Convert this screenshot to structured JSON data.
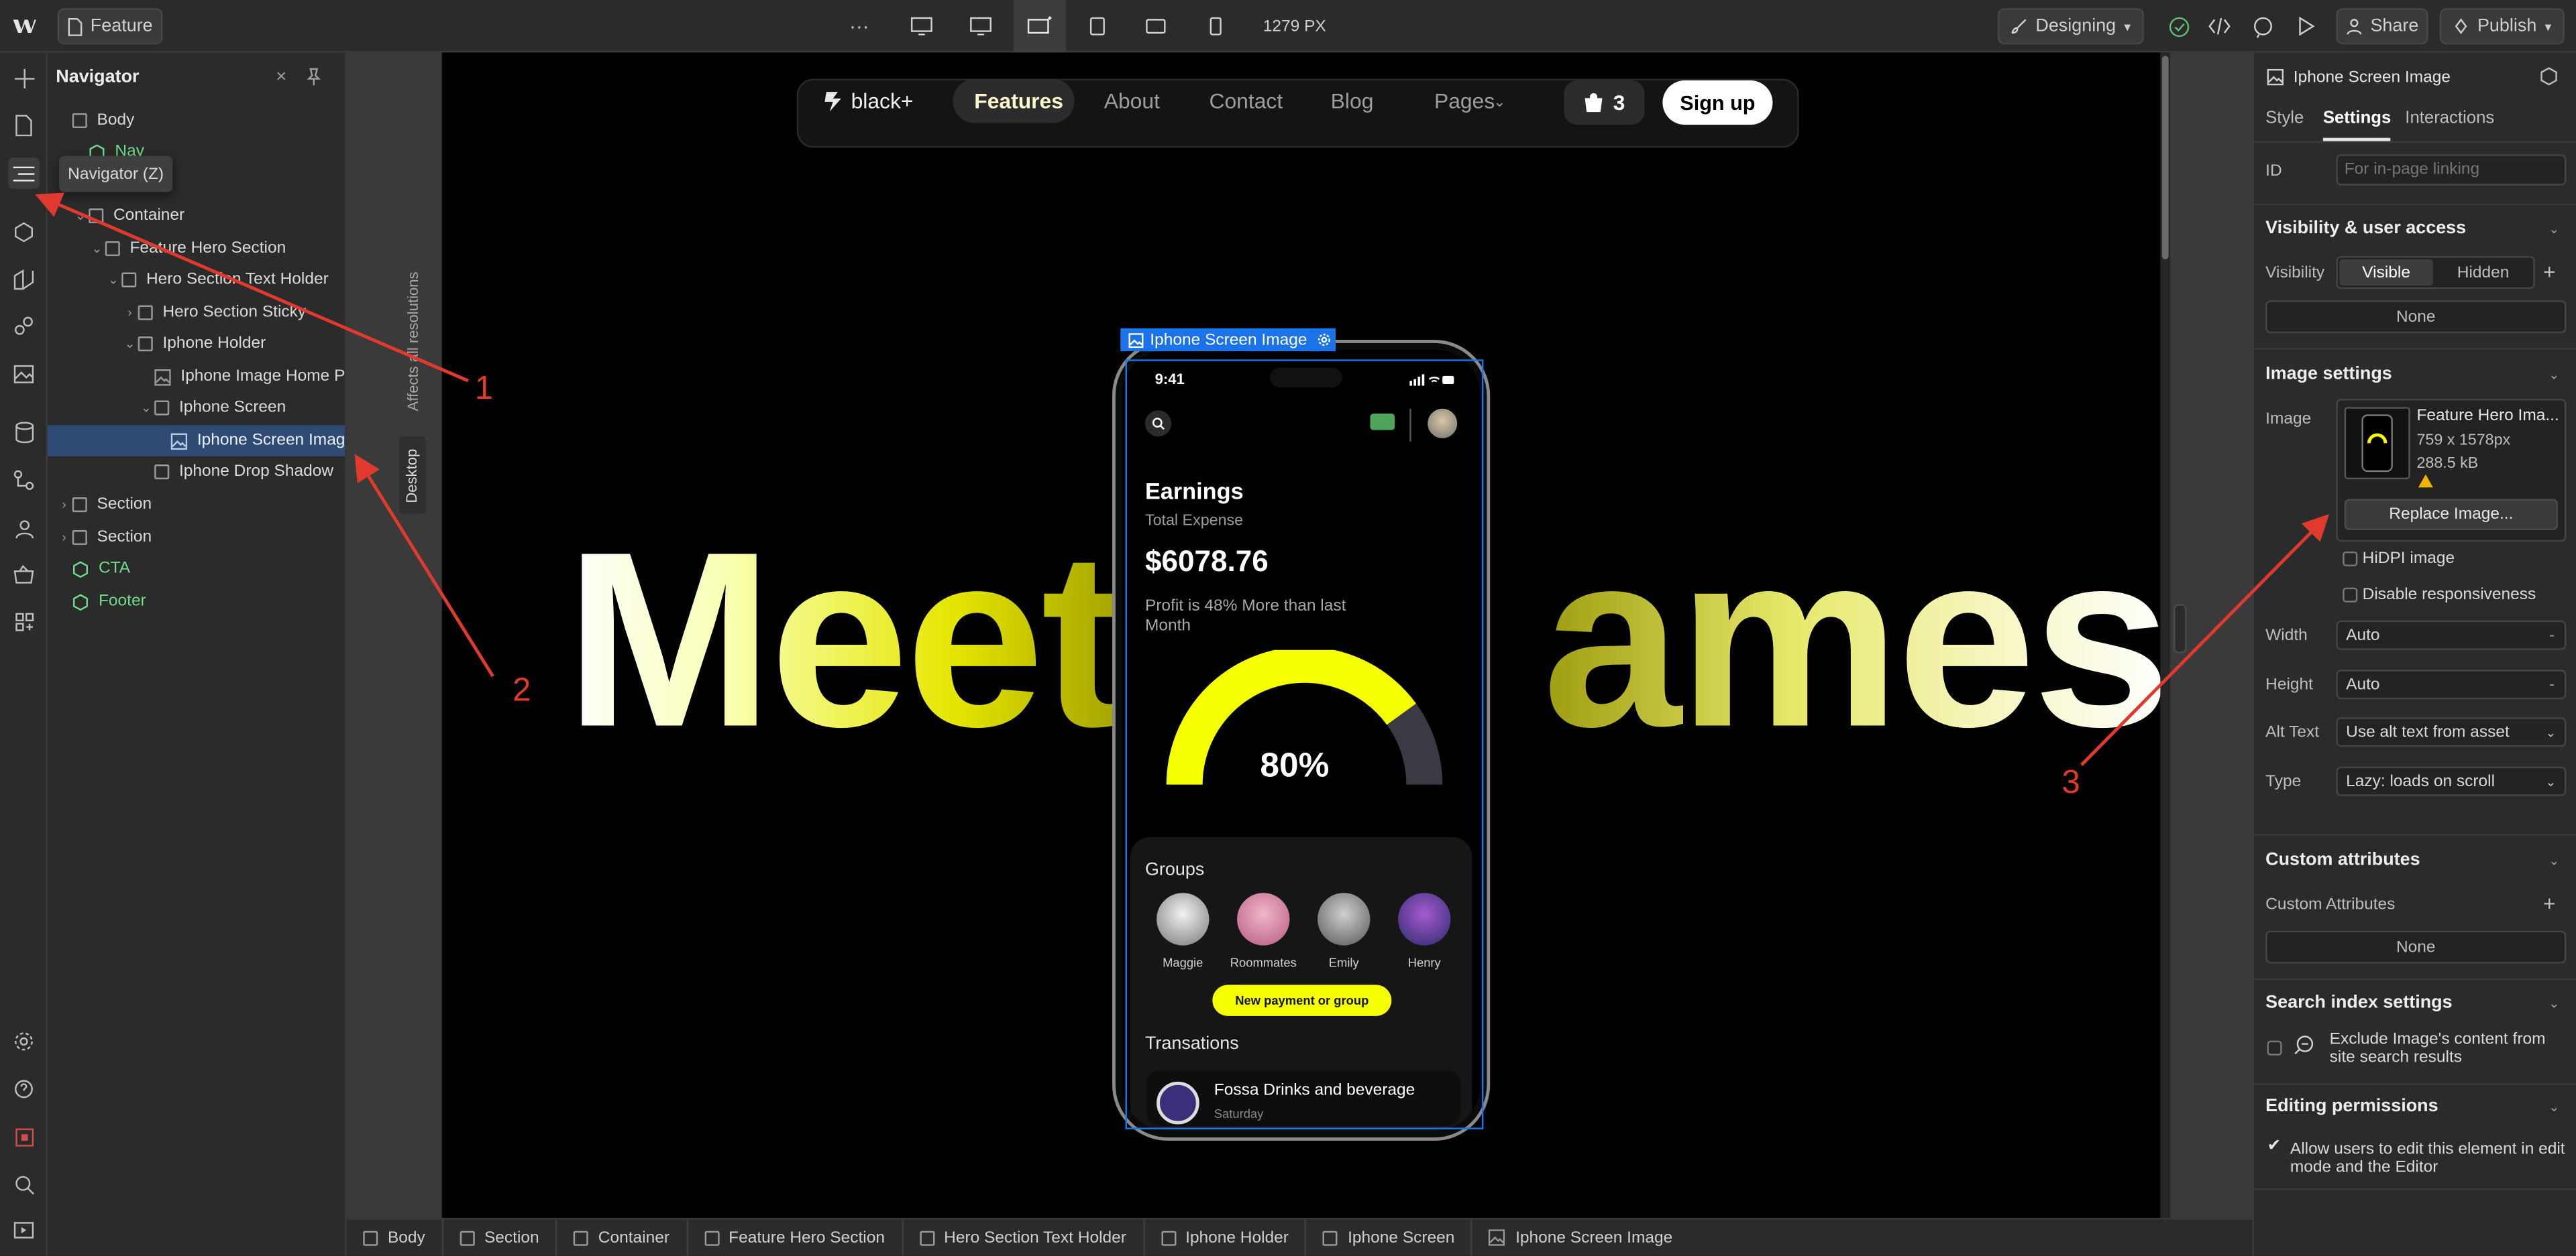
{
  "topbar": {
    "page_name": "Feature",
    "more": "···",
    "width_readout": "1279 PX",
    "mode": "Designing",
    "share": "Share",
    "publish": "Publish"
  },
  "tooltip": "Navigator (Z)",
  "navigator": {
    "title": "Navigator",
    "items": [
      {
        "label": "Body"
      },
      {
        "label": "Nav"
      },
      {
        "label": "Container"
      },
      {
        "label": "Feature Hero Section"
      },
      {
        "label": "Hero Section Text Holder"
      },
      {
        "label": "Hero Section Sticky"
      },
      {
        "label": "Iphone Holder"
      },
      {
        "label": "Iphone Image Home Pa"
      },
      {
        "label": "Iphone Screen"
      },
      {
        "label": "Iphone Screen Image"
      },
      {
        "label": "Iphone Drop Shadow"
      },
      {
        "label": "Section"
      },
      {
        "label": "Section"
      },
      {
        "label": "CTA"
      },
      {
        "label": "Footer"
      }
    ]
  },
  "canvas": {
    "side_tab_1": "Affects all resolutions",
    "side_tab_2": "Desktop",
    "selected_label": "Iphone Screen Image",
    "site": {
      "brand": "black+",
      "nav": [
        "Features",
        "About",
        "Contact",
        "Blog",
        "Pages"
      ],
      "cart_count": "3",
      "signup": "Sign up",
      "hero_left": "Meet",
      "hero_right": "ames"
    },
    "phone": {
      "time": "9:41",
      "earnings_title": "Earnings",
      "total_expense": "Total Expense",
      "amount": "$6078.76",
      "profit": "Profit is 48% More than last Month",
      "gauge_percent": 0.8,
      "gauge_label": "80%",
      "groups_title": "Groups",
      "groups": [
        "Maggie",
        "Roommates",
        "Emily",
        "Henry"
      ],
      "new_payment": "New payment or group",
      "transactions_title": "Transations",
      "transaction_name": "Fossa Drinks and beverage",
      "transaction_day": "Saturday"
    }
  },
  "annotations": [
    "1",
    "2",
    "3"
  ],
  "panel": {
    "element_title": "Iphone Screen Image",
    "tabs": [
      "Style",
      "Settings",
      "Interactions"
    ],
    "id_label": "ID",
    "id_placeholder": "For in-page linking",
    "visibility_section": "Visibility & user access",
    "visibility_label": "Visibility",
    "visible": "Visible",
    "hidden": "Hidden",
    "visibility_none": "None",
    "image_settings": "Image settings",
    "image_label": "Image",
    "image_name": "Feature Hero Ima...",
    "image_dims": "759 x 1578px",
    "image_size": "288.5 kB",
    "replace": "Replace Image...",
    "hidpi": "HiDPI image",
    "disable_resp": "Disable responsiveness",
    "width_label": "Width",
    "width_value": "Auto",
    "height_label": "Height",
    "height_value": "Auto",
    "alt_label": "Alt Text",
    "alt_value": "Use alt text from asset",
    "type_label": "Type",
    "type_value": "Lazy: loads on scroll",
    "custom_attr_section": "Custom attributes",
    "custom_attr_label": "Custom Attributes",
    "custom_attr_none": "None",
    "search_section": "Search index settings",
    "search_exclude": "Exclude Image's content from site search results",
    "perm_section": "Editing permissions",
    "perm_text": "Allow users to edit this element in edit mode and the Editor"
  },
  "breadcrumb": [
    "Body",
    "Section",
    "Container",
    "Feature Hero Section",
    "Hero Section Text Holder",
    "Iphone Holder",
    "Iphone Screen",
    "Iphone Screen Image"
  ],
  "colors": {
    "selection_blue": "#1a73e8",
    "annotation_red": "#e03a2f",
    "accent_yellow": "#f5ff00",
    "component_green": "#6fdc8c"
  }
}
